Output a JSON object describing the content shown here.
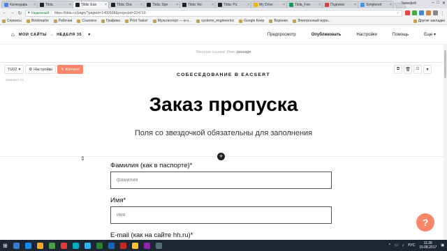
{
  "browser": {
    "tabs": [
      {
        "label": "Календарь",
        "color": "#4a86e8",
        "active": false
      },
      {
        "label": "Tilda",
        "color": "#222222",
        "active": false
      },
      {
        "label": "Tilda: Eas",
        "color": "#222222",
        "active": true
      },
      {
        "label": "Tilda: Dra",
        "color": "#222222",
        "active": false
      },
      {
        "label": "Tilda: Spe",
        "color": "#222222",
        "active": false
      },
      {
        "label": "Tilda: Re",
        "color": "#222222",
        "active": false
      },
      {
        "label": "Tilda: Pu",
        "color": "#222222",
        "active": false
      },
      {
        "label": "My Drive",
        "color": "#f4b400",
        "active": false
      },
      {
        "label": "Tilda_Fee",
        "color": "#0f9d58",
        "active": false
      },
      {
        "label": "Подписи",
        "color": "#db4437",
        "active": false
      },
      {
        "label": "Simplenot",
        "color": "#3d9ae8",
        "active": false
      }
    ],
    "profile": "Тимофей",
    "secure_label": "Надежный",
    "url": "https://tilda.cc/page/?pageid=1400508&projectid=324716",
    "bookmarks": [
      "Сервисы",
      "Bookmarks",
      "Рабочая",
      "Coursera",
      "Графика",
      "Print Tasks!",
      "Мультиспорт — в н...",
      "systems_engineerinc",
      "Google Keep",
      "Воронки",
      "Электронный журн..."
    ],
    "other_bookmarks": "Другие закладки"
  },
  "tilda": {
    "crumb1": "МОИ САЙТЫ",
    "crumb2": "НЕДЕЛЯ 35",
    "nav": {
      "preview": "Предпросмотр",
      "publish": "Опубликовать",
      "settings": "Настройки",
      "help": "Помощь",
      "more": "Еще"
    },
    "anchor_prefix": "Якорная ссылка: Имя:",
    "anchor_name": "passage",
    "block": {
      "type_btn": "TU02",
      "settings_btn": "Настройки",
      "content_btn": "Контент",
      "block_id": "Заявлено: 04"
    }
  },
  "form": {
    "eyebrow": "СОБЕСЕДОВАНИЕ В EACSERT",
    "title": "Заказ пропуска",
    "subtitle": "Поля со звездочкой обязательны для заполнения",
    "fields": [
      {
        "label": "Фамилия (как в паспорте)*",
        "placeholder": "фамилия"
      },
      {
        "label": "Имя*",
        "placeholder": "имя"
      },
      {
        "label": "E-mail (как на сайте hh.ru)*"
      }
    ]
  },
  "taskbar": {
    "lang": "РУС",
    "time": "11:26",
    "date": "15.08.2017"
  },
  "colors": {
    "accent": "#fa8669",
    "taskbar": "#1c2733"
  }
}
